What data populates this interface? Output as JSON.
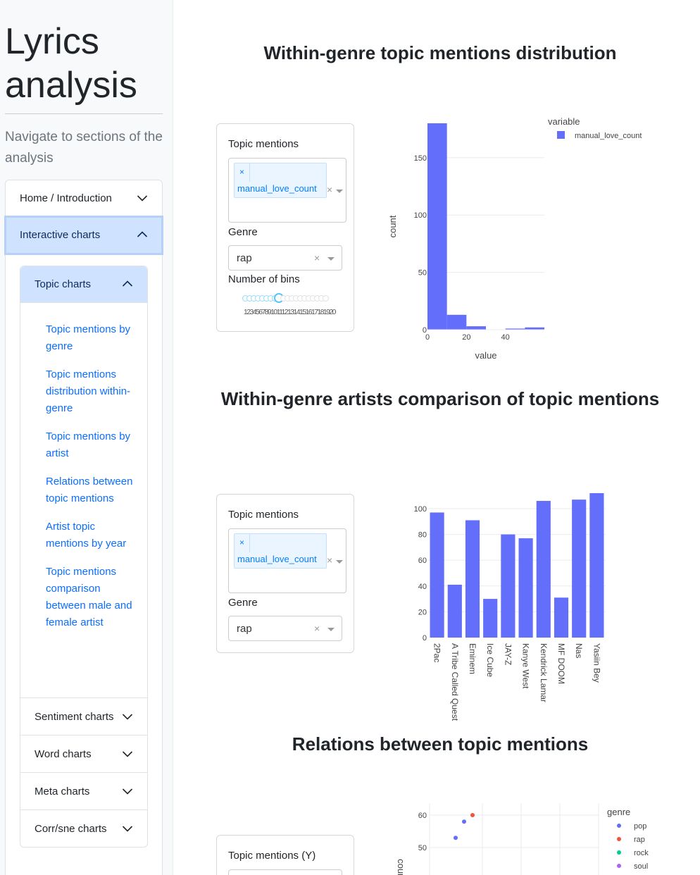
{
  "sidebar": {
    "app_title_line1": "Lyrics",
    "app_title_line2": "analysis",
    "description": "Navigate to sections of the analysis",
    "sections": [
      {
        "label": "Home / Introduction"
      },
      {
        "label": "Interactive charts"
      }
    ],
    "sub_sections": {
      "topic": "Topic charts",
      "links": [
        "Topic mentions by genre",
        "Topic mentions distribution within-genre",
        "Topic mentions by artist",
        "Relations between topic mentions",
        "Artist topic mentions by year",
        "Topic mentions comparison between male and female artist"
      ],
      "others": [
        "Sentiment charts",
        "Word charts",
        "Meta charts",
        "Corr/sne charts"
      ]
    }
  },
  "sections": [
    {
      "title": "Within-genre topic mentions distribution",
      "topic_label": "Topic mentions",
      "topic_tag": "manual_love_count",
      "tag_remove": "×",
      "genre_label": "Genre",
      "genre_value": "rap",
      "bins_label": "Number of bins",
      "bins_marks": "1234567891011121314151617181920",
      "bins_value": 9
    },
    {
      "title": "Within-genre artists comparison of topic mentions",
      "topic_label": "Topic mentions",
      "topic_tag": "manual_love_count",
      "tag_remove": "×",
      "genre_label": "Genre",
      "genre_value": "rap"
    },
    {
      "title": "Relations between topic mentions",
      "topic_label": "Topic mentions (Y)"
    }
  ],
  "chart_data": [
    {
      "type": "bar",
      "subtype": "histogram",
      "xlabel": "value",
      "ylabel": "count",
      "legend_title": "variable",
      "series": [
        {
          "name": "manual_love_count",
          "color": "#636efa"
        }
      ],
      "bins": [
        [
          0,
          10,
          180
        ],
        [
          10,
          20,
          13
        ],
        [
          20,
          30,
          3
        ],
        [
          30,
          40,
          0
        ],
        [
          40,
          50,
          1
        ],
        [
          50,
          60,
          2
        ]
      ],
      "xticks": [
        0,
        20,
        40
      ],
      "yticks": [
        0,
        50,
        100,
        150
      ],
      "xlim": [
        0,
        60
      ],
      "ylim": [
        0,
        180
      ]
    },
    {
      "type": "bar",
      "categories": [
        "2Pac",
        "A Tribe Called Quest",
        "Eminem",
        "Ice Cube",
        "JAY-Z",
        "Kanye West",
        "Kendrick Lamar",
        "MF DOOM",
        "Nas",
        "Yasiin Bey"
      ],
      "values": [
        97,
        41,
        91,
        30,
        80,
        77,
        106,
        31,
        107,
        112
      ],
      "yticks": [
        0,
        20,
        40,
        60,
        80,
        100
      ],
      "ylim": [
        0,
        112
      ],
      "color": "#636efa"
    },
    {
      "type": "scatter",
      "ylabel": "count",
      "legend_title": "genre",
      "yticks": [
        50,
        60
      ],
      "legend": [
        {
          "name": "pop",
          "color": "#636efa"
        },
        {
          "name": "rap",
          "color": "#ef553b"
        },
        {
          "name": "rock",
          "color": "#00cc96"
        },
        {
          "name": "soul",
          "color": "#ab63fa"
        }
      ],
      "points": [
        {
          "genre": "pop",
          "y": 53
        },
        {
          "genre": "pop",
          "y": 58
        },
        {
          "genre": "rap",
          "y": 60
        }
      ]
    }
  ],
  "icons": {
    "chevron_down": "chevron-down-icon",
    "chevron_up": "chevron-up-icon"
  }
}
